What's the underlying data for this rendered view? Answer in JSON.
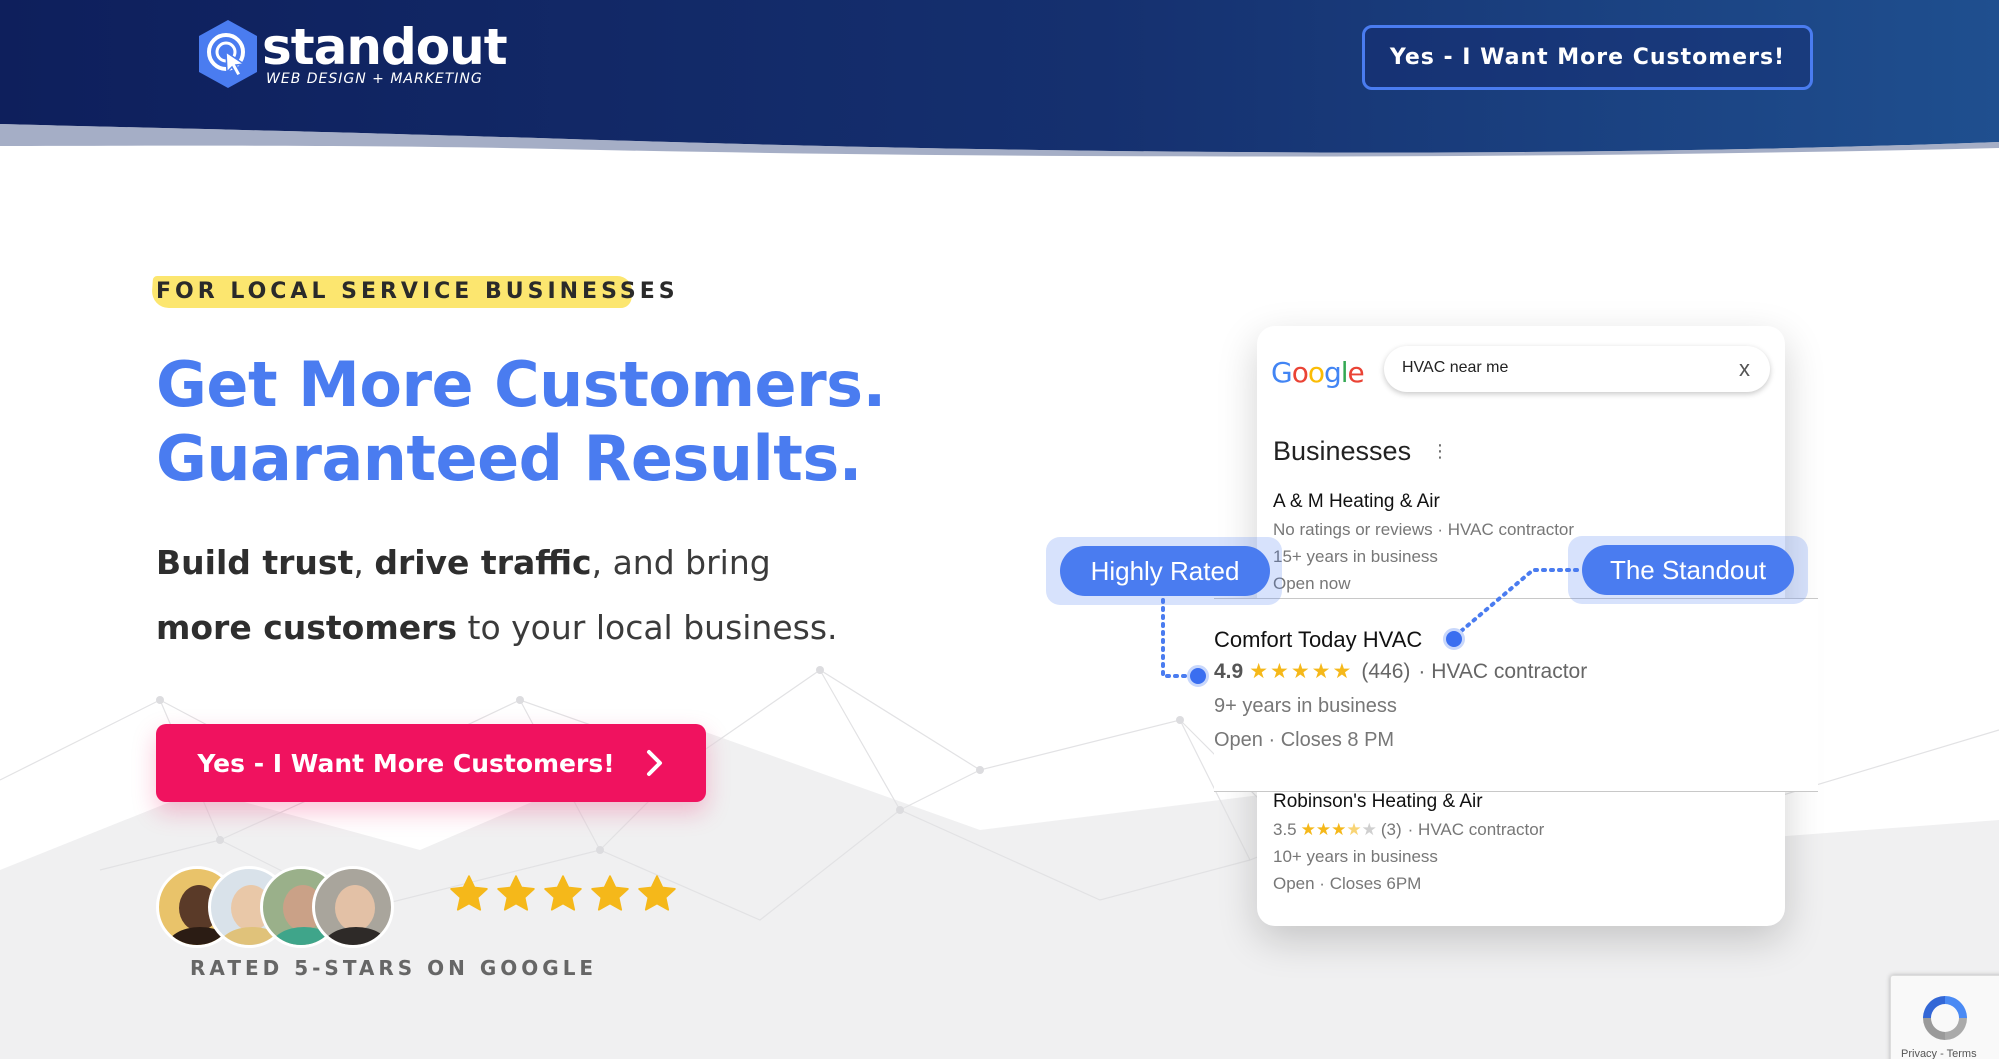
{
  "header": {
    "logo_word": "standout",
    "logo_tagline": "WEB DESIGN + MARKETING",
    "cta_label": "Yes - I Want More Customers!"
  },
  "hero": {
    "eyebrow": "FOR LOCAL SERVICE BUSINESSES",
    "headline_line1": "Get More Customers.",
    "headline_line2": "Guaranteed Results.",
    "sub": {
      "b1": "Build trust",
      "t1": ", ",
      "b2": "drive traffic",
      "t2": ", and bring ",
      "b3": "more customers",
      "t3": " to your local business."
    },
    "cta_label": "Yes - I Want More Customers!",
    "rating_stars": 5,
    "rated_text": "RATED 5-STARS ON GOOGLE"
  },
  "google_card": {
    "logo": "Google",
    "search_query": "HVAC near me",
    "clear_label": "x",
    "section_title": "Businesses",
    "listings": [
      {
        "name": "A & M Heating & Air",
        "line1": "No ratings or reviews · HVAC contractor",
        "line2": "15+ years in business",
        "line3": "Open now"
      },
      {
        "name": "Comfort Today HVAC",
        "rating": "4.9",
        "reviews": "(446)",
        "category": "· HVAC contractor",
        "line2": "9+ years in business",
        "line3": "Open · Closes 8 PM"
      },
      {
        "name": "Robinson's Heating & Air",
        "rating": "3.5",
        "reviews": "(3)",
        "category": "· HVAC contractor",
        "line2": "10+ years in business",
        "line3": "Open · Closes 6PM"
      }
    ],
    "pill_left": "Highly Rated",
    "pill_right": "The Standout"
  },
  "recaptcha": {
    "text": "Privacy - Terms"
  },
  "colors": {
    "brand_blue": "#4a7cf0",
    "header_navy": "#132a6b",
    "cta_pink": "#f0125f",
    "highlight_yellow": "#fce66f",
    "star_gold": "#f5b81a"
  }
}
